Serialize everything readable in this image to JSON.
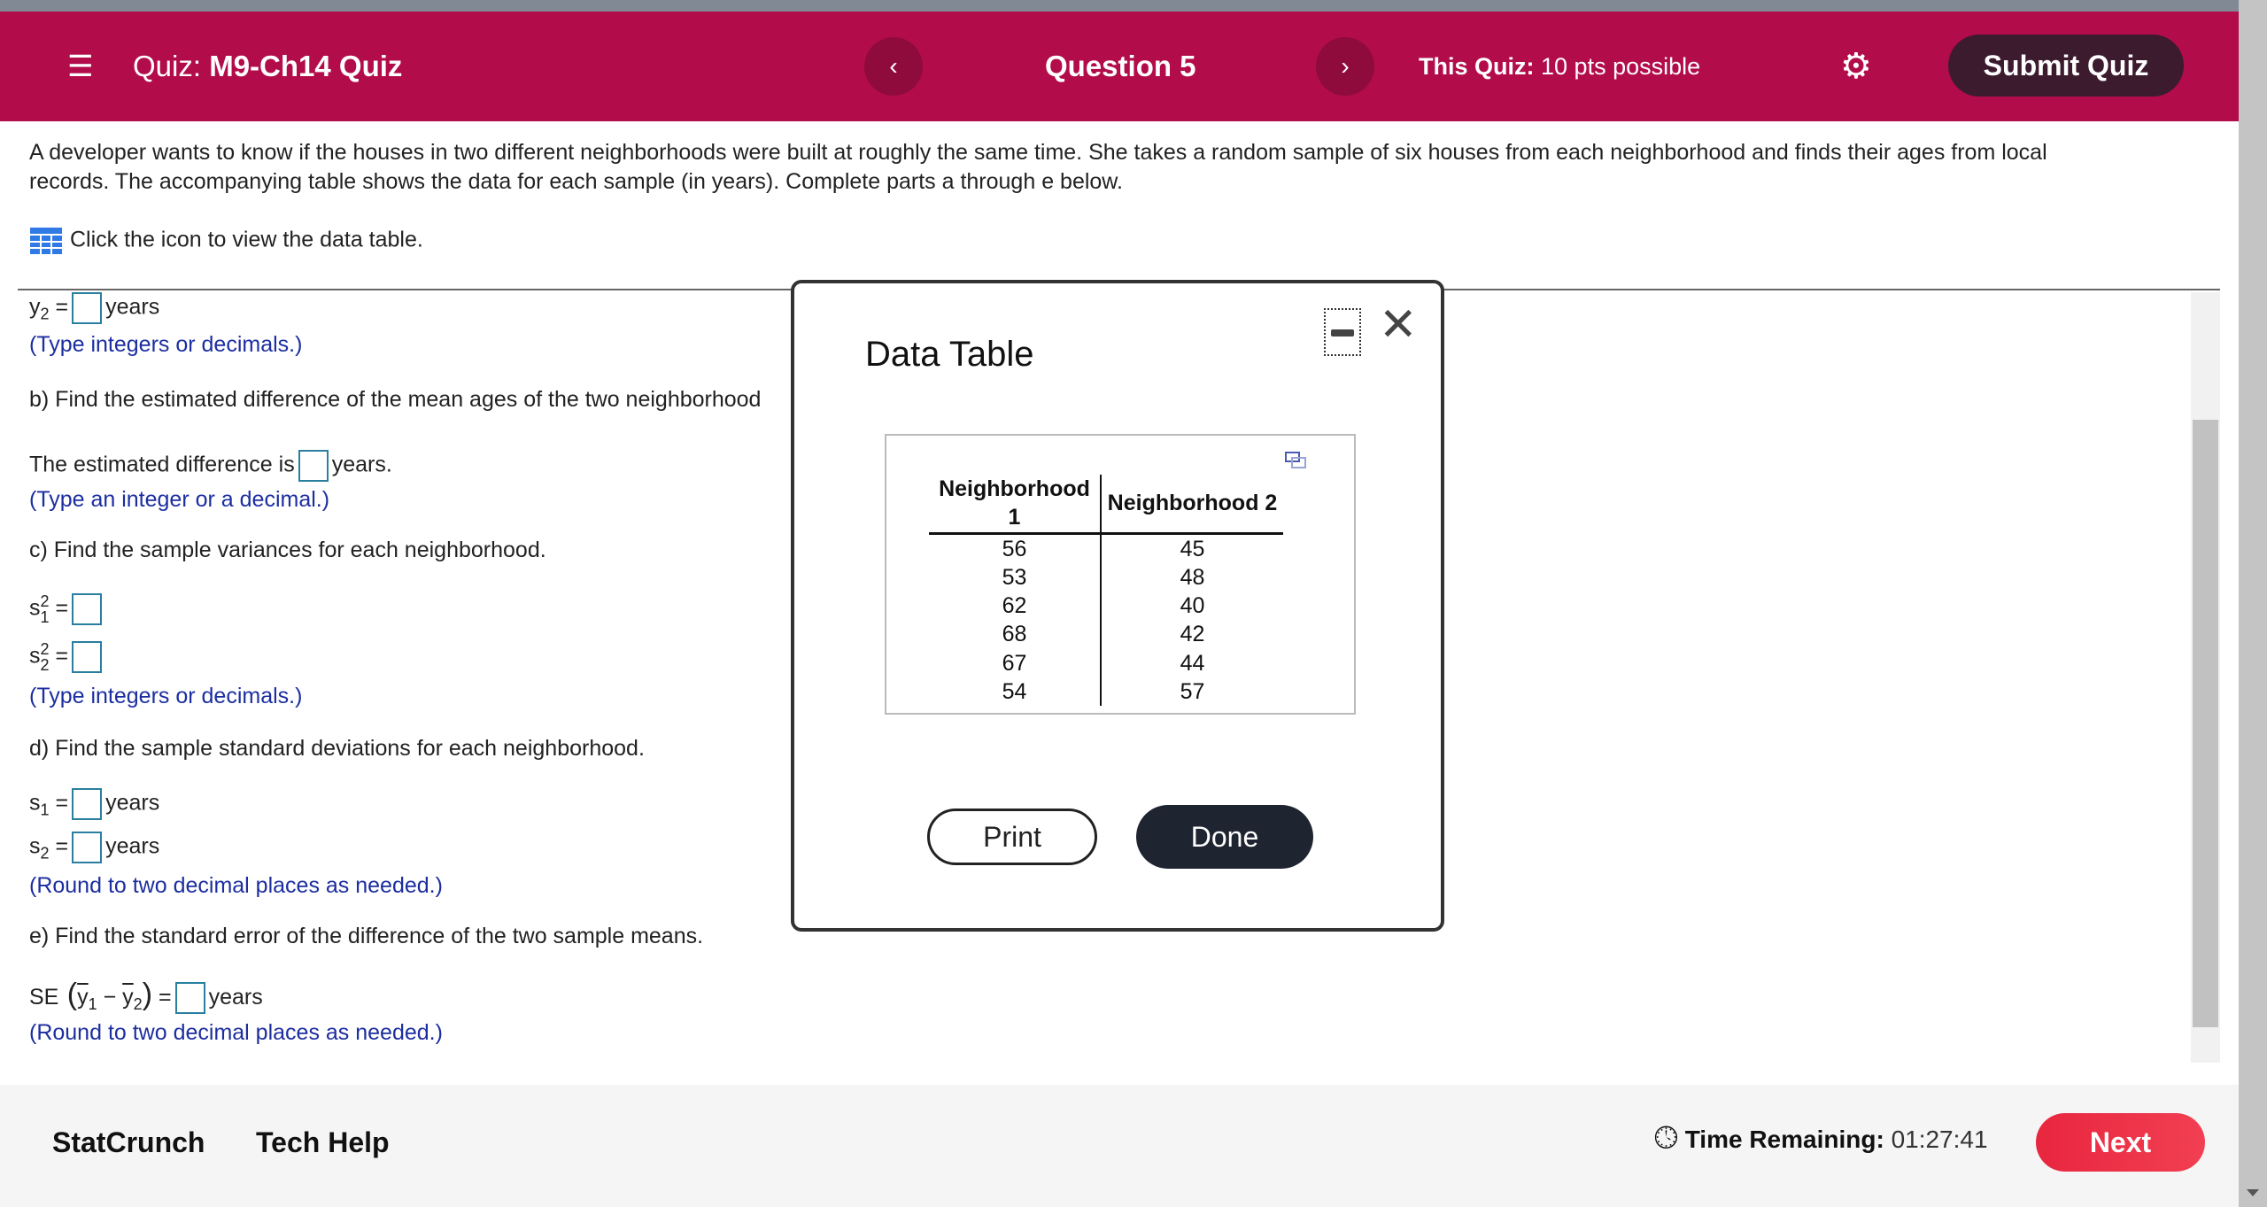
{
  "header": {
    "quiz_label": "Quiz:",
    "quiz_name": "M9-Ch14 Quiz",
    "question": "Question 5",
    "points_label": "This Quiz:",
    "points_value": "10 pts possible",
    "submit": "Submit Quiz",
    "prev": "‹",
    "next": "›",
    "colors": {
      "header": "#b20c4a",
      "submit": "#3d1b2f"
    }
  },
  "question": {
    "intro": "A developer wants to know if the houses in two different neighborhoods were built at roughly the same time. She takes a random sample of six houses from each neighborhood and finds their ages from local",
    "intro2": "records. The accompanying table shows the data for each sample (in years). Complete parts a through e below.",
    "click_hint": "Click the icon to view the data table."
  },
  "parts": {
    "y2_label": "y",
    "y2_sub": "2",
    "eq": "=",
    "years": "years",
    "years_dot": "years.",
    "hint_integers": "(Type integers or decimals.)",
    "b": "b) Find the estimated difference of the mean ages of the two neighborhood",
    "b_answer": "The estimated difference is",
    "hint_integer": "(Type an integer or a decimal.)",
    "c": "c) Find the sample variances for each neighborhood.",
    "s": "s",
    "sub1": "1",
    "sub2": "2",
    "sup2": "2",
    "d": "d) Find the sample standard deviations for each neighborhood.",
    "hint_round": "(Round to two decimal places as needed.)",
    "e": "e) Find the standard error of the difference of the two sample means.",
    "se": "SE",
    "minus": "−"
  },
  "footer": {
    "statcrunch": "StatCrunch",
    "techhelp": "Tech Help",
    "time_label": "Time Remaining:",
    "time_value": "01:27:41",
    "next": "Next"
  },
  "dialog": {
    "title": "Data Table",
    "print": "Print",
    "done": "Done",
    "table": {
      "headers": [
        "Neighborhood 1",
        "Neighborhood 2"
      ],
      "rows": [
        [
          "56",
          "45"
        ],
        [
          "53",
          "48"
        ],
        [
          "62",
          "40"
        ],
        [
          "68",
          "42"
        ],
        [
          "67",
          "44"
        ],
        [
          "54",
          "57"
        ]
      ]
    }
  }
}
